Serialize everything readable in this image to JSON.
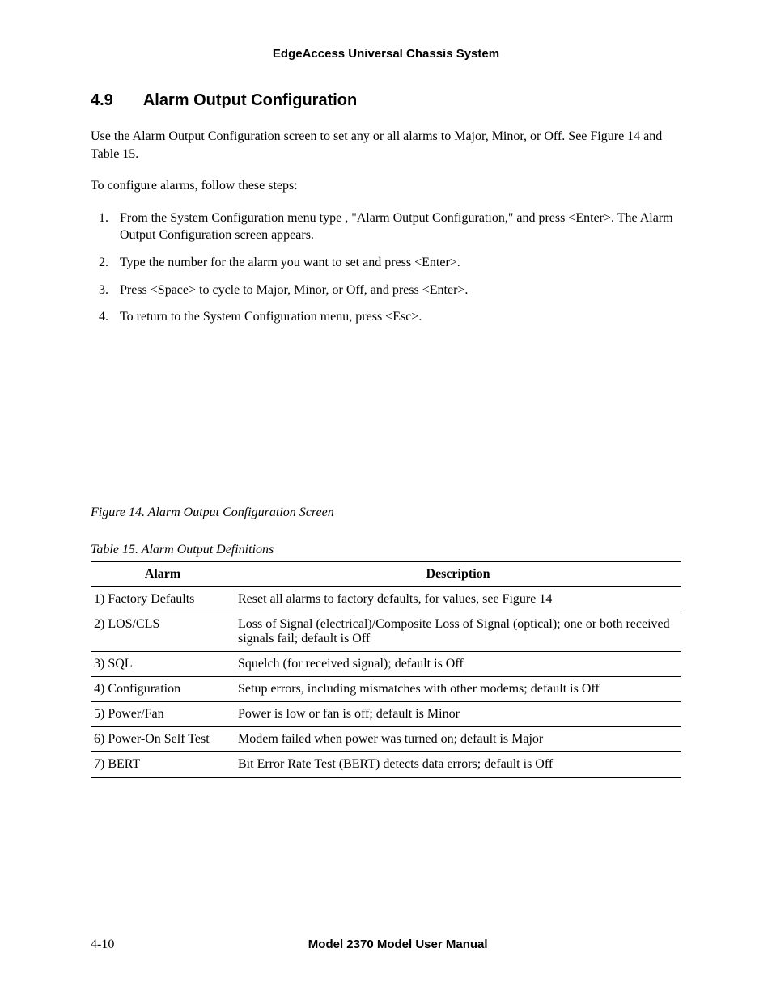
{
  "header": {
    "running_title": "EdgeAccess Universal Chassis System"
  },
  "section": {
    "number": "4.9",
    "title": "Alarm Output Configuration"
  },
  "paragraphs": {
    "intro": "Use the Alarm Output Configuration screen to set any or all alarms to Major, Minor, or Off.  See Figure 14 and Table 15.",
    "lead_in": "To configure alarms, follow these steps:"
  },
  "steps": [
    "From the System Configuration menu type   , \"Alarm Output Configuration,\" and press <Enter>. The Alarm Output Configuration screen appears.",
    "Type the number for the alarm you want to set and press <Enter>.",
    "Press <Space> to cycle to Major, Minor, or Off, and press <Enter>.",
    "To return to the System Configuration menu, press <Esc>."
  ],
  "figure_caption": "Figure 14.  Alarm Output Configuration Screen",
  "table_caption": "Table 15.  Alarm Output Definitions",
  "table": {
    "headers": {
      "alarm": "Alarm",
      "description": "Description"
    },
    "rows": [
      {
        "alarm": "1) Factory Defaults",
        "description": "Reset all alarms to factory defaults, for values, see Figure 14"
      },
      {
        "alarm": "2) LOS/CLS",
        "description": "Loss of Signal (electrical)/Composite Loss of Signal (optical); one or both received signals fail; default is Off"
      },
      {
        "alarm": "3) SQL",
        "description": "Squelch (for received signal); default is Off"
      },
      {
        "alarm": "4) Configuration",
        "description": "Setup errors, including mismatches with other modems; default is Off"
      },
      {
        "alarm": "5) Power/Fan",
        "description": "Power is low or fan is off; default is Minor"
      },
      {
        "alarm": "6) Power-On Self Test",
        "description": "Modem failed when power was turned on; default is Major"
      },
      {
        "alarm": "7) BERT",
        "description": "Bit Error Rate Test (BERT) detects data errors; default is Off"
      }
    ]
  },
  "footer": {
    "page_number": "4-10",
    "manual_title": "Model 2370 Model User Manual"
  }
}
